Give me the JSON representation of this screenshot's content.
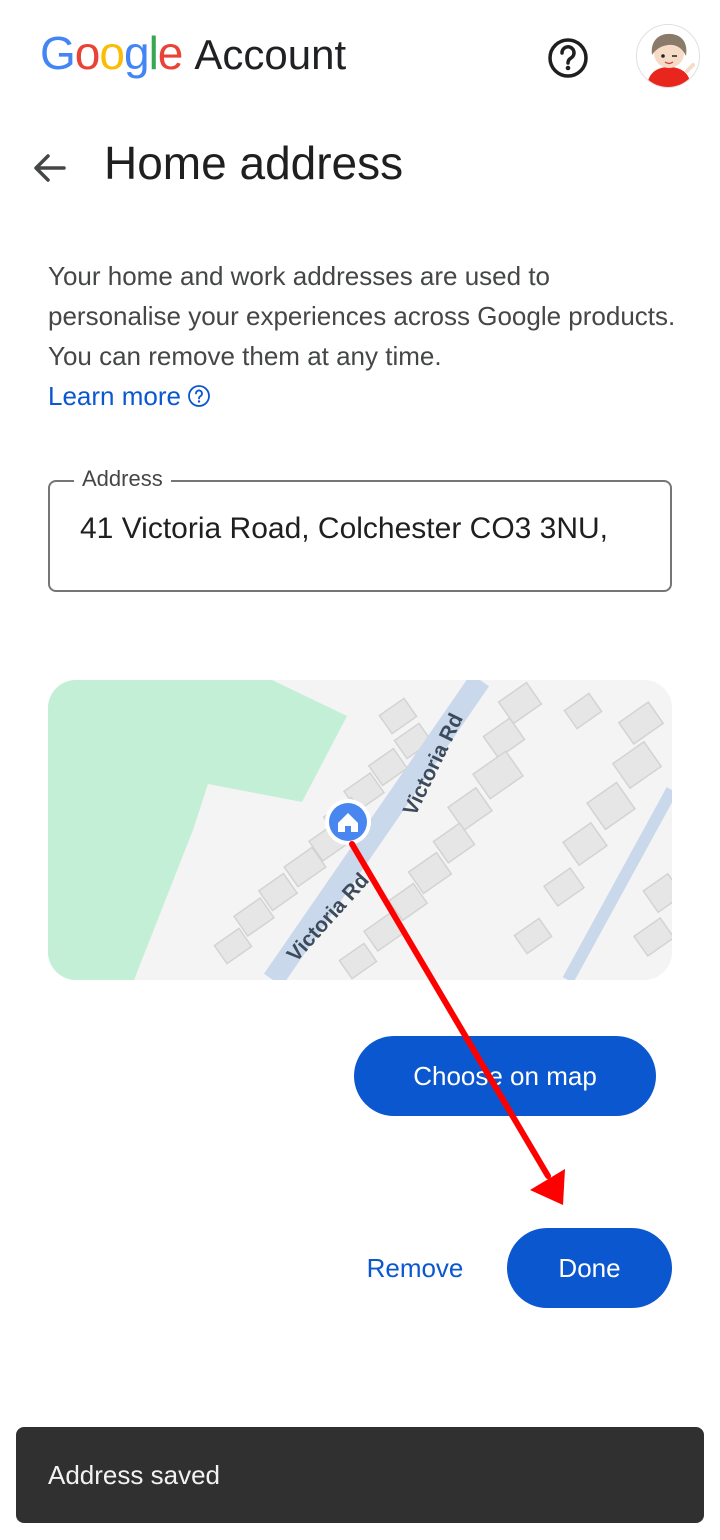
{
  "header": {
    "logo_letters": [
      {
        "char": "G",
        "color": "#4285F4"
      },
      {
        "char": "o",
        "color": "#EA4335"
      },
      {
        "char": "o",
        "color": "#FBBC05"
      },
      {
        "char": "g",
        "color": "#4285F4"
      },
      {
        "char": "l",
        "color": "#34A853"
      },
      {
        "char": "e",
        "color": "#EA4335"
      }
    ],
    "account_label": "Account",
    "help_icon": "help-circle-icon",
    "avatar_icon": "user-avatar"
  },
  "page": {
    "back_icon": "arrow-back-icon",
    "title": "Home address",
    "description": "Your home and work addresses are used to personalise your experiences across Google products. You can remove them at any time.",
    "learn_more": "Learn more",
    "learn_more_icon": "help-circle-icon"
  },
  "address": {
    "label": "Address",
    "value": "41 Victoria Road, Colchester CO3 3NU,"
  },
  "map": {
    "street_labels": [
      "Victoria Rd",
      "Victoria Rd"
    ],
    "marker_icon": "home-pin-icon",
    "colors": {
      "park": "#c3efd6",
      "road": "#c9d8ea",
      "building": "#e6e6e6",
      "background": "#f4f4f4"
    }
  },
  "actions": {
    "choose_on_map": "Choose on map",
    "remove": "Remove",
    "done": "Done"
  },
  "snackbar": {
    "text": "Address saved"
  },
  "colors": {
    "primary": "#0b57d0",
    "annotation_arrow": "#ff0000",
    "snackbar_bg": "#303030"
  }
}
